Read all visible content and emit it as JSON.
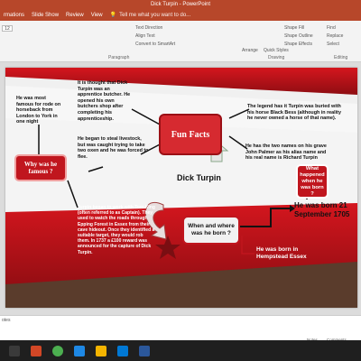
{
  "window": {
    "title": "Dick Turpin - PowerPoint"
  },
  "tabs": [
    "rmations",
    "Slide Show",
    "Review",
    "View"
  ],
  "tellme": "Tell me what you want to do...",
  "ribbon": {
    "font_size": "12",
    "text_direction": "Text Direction",
    "align_text": "Align Text",
    "convert_smartart": "Convert to SmartArt",
    "paragraph_label": "Paragraph",
    "arrange": "Arrange",
    "quick_styles": "Quick Styles",
    "shape_fill": "Shape Fill",
    "shape_outline": "Shape Outline",
    "shape_effects": "Shape Effects",
    "drawing_label": "Drawing",
    "find": "Find",
    "replace": "Replace",
    "select": "Select",
    "editing_label": "Editing"
  },
  "slide": {
    "title": "Dick Turpin",
    "fun_facts": "Fun Facts",
    "why_famous": "Why was he famous ?",
    "when_where": "When and where was he born ?",
    "what_happened": "What happened when he was born ?",
    "born_date": "He was born 21 September 1705",
    "born_place": "He was born in Hempstead Essex",
    "famous_text": "He was most famous for rode on horseback from London to York in one night",
    "butcher_text": "It is thought that Dick Turpin was an apprentice butcher. He opened his own butchers shop after completing his apprenticeship.",
    "livestock_text": "He began to steal livestock, but was caught trying to take two oxen and he was forced to flee.",
    "buried_text": "The legend has it Turpin was buried with his horse Black Bess (although in reality he never owned a horse of that name).",
    "names_text": "He has the two names on his grave John Palmer as his alias name and his real name is Richard Turpin",
    "gang_text": "Turpin began to work with Tom King (often referred to as Captain). They used to watch the roads through Epping Forest in Essex from their cave hideout. Once they identified a suitable target, they would rob them. In 1737 a £100 reward was announced for the capture of Dick Turpin."
  },
  "notes": "otes",
  "status": {
    "notes": "Notes",
    "comments": "Comments"
  },
  "colors": {
    "accent": "#b7472a",
    "slide_red": "#c0161e",
    "dark_red": "#8e0d12"
  }
}
